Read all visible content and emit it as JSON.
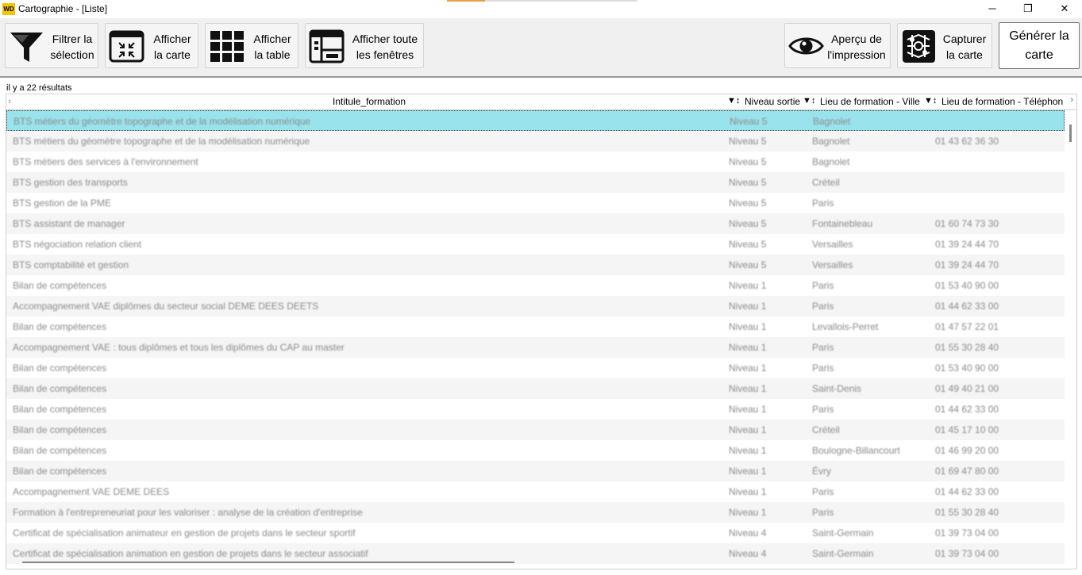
{
  "window": {
    "logo": "WD",
    "title": "Cartographie - [Liste]",
    "controls": {
      "minimize": "─",
      "maximize": "❐",
      "close": "✕"
    }
  },
  "toolbar": {
    "filter": "Filtrer la\nsélection",
    "show_map": "Afficher\nla carte",
    "show_table": "Afficher\nla table",
    "show_all": "Afficher toute\nles fenêtres",
    "preview": "Aperçu de\nl'impression",
    "capture": "Capturer\nla carte",
    "generate": "Générer la\ncarte"
  },
  "results": {
    "count_text": "il y a 22 résultats"
  },
  "table": {
    "columns": [
      {
        "label": "Intitule_formation"
      },
      {
        "label": "Niveau sortie"
      },
      {
        "label": "Lieu de formation - Ville"
      },
      {
        "label": "Lieu de formation - Téléphon"
      }
    ],
    "rows": [
      {
        "c1": "BTS métiers du géomètre topographe et de la modélisation numérique",
        "c2": "Niveau 5",
        "c3": "Bagnolet",
        "c4": ""
      },
      {
        "c1": "BTS métiers du géomètre topographe et de la modélisation numérique",
        "c2": "Niveau 5",
        "c3": "Bagnolet",
        "c4": "01 43 62 36 30"
      },
      {
        "c1": "BTS métiers des services à l'environnement",
        "c2": "Niveau 5",
        "c3": "Bagnolet",
        "c4": ""
      },
      {
        "c1": "BTS gestion des transports",
        "c2": "Niveau 5",
        "c3": "Créteil",
        "c4": ""
      },
      {
        "c1": "BTS gestion de la PME",
        "c2": "Niveau 5",
        "c3": "Paris",
        "c4": ""
      },
      {
        "c1": "BTS assistant de manager",
        "c2": "Niveau 5",
        "c3": "Fontainebleau",
        "c4": "01 60 74 73 30"
      },
      {
        "c1": "BTS négociation relation client",
        "c2": "Niveau 5",
        "c3": "Versailles",
        "c4": "01 39 24 44 70"
      },
      {
        "c1": "BTS comptabilité et gestion",
        "c2": "Niveau 5",
        "c3": "Versailles",
        "c4": "01 39 24 44 70"
      },
      {
        "c1": "Bilan de compétences",
        "c2": "Niveau 1",
        "c3": "Paris",
        "c4": "01 53 40 90 00"
      },
      {
        "c1": "Accompagnement VAE diplômes du secteur social DEME DEES DEETS",
        "c2": "Niveau 1",
        "c3": "Paris",
        "c4": "01 44 62 33 00"
      },
      {
        "c1": "Bilan de compétences",
        "c2": "Niveau 1",
        "c3": "Levallois-Perret",
        "c4": "01 47 57 22 01"
      },
      {
        "c1": "Accompagnement VAE : tous diplômes et tous les diplômes du CAP au master",
        "c2": "Niveau 1",
        "c3": "Paris",
        "c4": "01 55 30 28 40"
      },
      {
        "c1": "Bilan de compétences",
        "c2": "Niveau 1",
        "c3": "Paris",
        "c4": "01 53 40 90 00"
      },
      {
        "c1": "Bilan de compétences",
        "c2": "Niveau 1",
        "c3": "Saint-Denis",
        "c4": "01 49 40 21 00"
      },
      {
        "c1": "Bilan de compétences",
        "c2": "Niveau 1",
        "c3": "Paris",
        "c4": "01 44 62 33 00"
      },
      {
        "c1": "Bilan de compétences",
        "c2": "Niveau 1",
        "c3": "Créteil",
        "c4": "01 45 17 10 00"
      },
      {
        "c1": "Bilan de compétences",
        "c2": "Niveau 1",
        "c3": "Boulogne-Billancourt",
        "c4": "01 46 99 20 00"
      },
      {
        "c1": "Bilan de compétences",
        "c2": "Niveau 1",
        "c3": "Évry",
        "c4": "01 69 47 80 00"
      },
      {
        "c1": "Accompagnement VAE DEME DEES",
        "c2": "Niveau 1",
        "c3": "Paris",
        "c4": "01 44 62 33 00"
      },
      {
        "c1": "Formation à l'entrepreneuriat pour les valoriser : analyse de la création d'entreprise",
        "c2": "Niveau 1",
        "c3": "Paris",
        "c4": "01 55 30 28 40"
      },
      {
        "c1": "Certificat de spécialisation animateur en gestion de projets dans le secteur sportif",
        "c2": "Niveau 4",
        "c3": "Saint-Germain",
        "c4": "01 39 73 04 00"
      },
      {
        "c1": "Certificat de spécialisation animation en gestion de projets dans le secteur associatif",
        "c2": "Niveau 4",
        "c3": "Saint-Germain",
        "c4": "01 39 73 04 00"
      }
    ]
  }
}
